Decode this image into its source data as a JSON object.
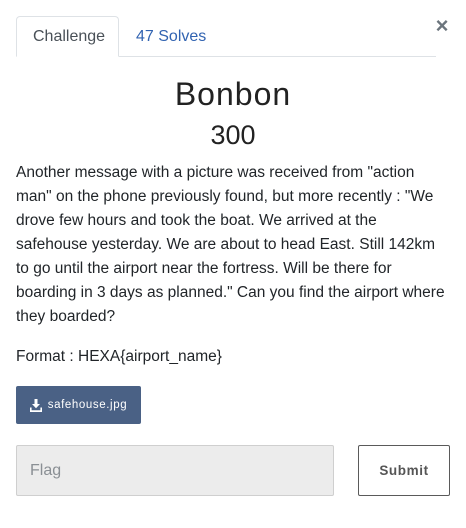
{
  "tabs": {
    "challenge_label": "Challenge",
    "solves_label": "47 Solves"
  },
  "close_glyph": "×",
  "challenge": {
    "name": "Bonbon",
    "points": "300",
    "description": "Another message with a picture was received from \"action man\" on the phone previously found, but more recently : \"We drove few hours and took the boat. We arrived at the safehouse yesterday. We are about to head East. Still 142km to go until the airport near the fortress. Will be there for boarding in 3 days as planned.\" Can you find the airport where they boarded?",
    "format": "Format : HEXA{airport_name}"
  },
  "attachment": {
    "filename": "safehouse.jpg",
    "icon": "download-icon"
  },
  "flag_input": {
    "placeholder": "Flag",
    "value": ""
  },
  "submit_label": "Submit",
  "colors": {
    "tab_link": "#3163b1",
    "download_button_bg": "#4a6185",
    "input_bg": "#ececec"
  }
}
